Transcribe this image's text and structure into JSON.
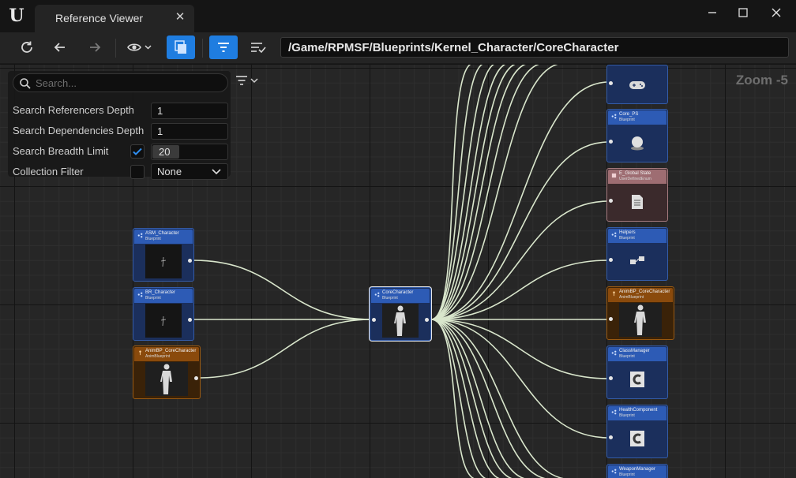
{
  "window": {
    "tab_title": "Reference Viewer",
    "close_glyph": "✕",
    "controls": {
      "minimize": "—",
      "maximize": "☐",
      "close": "✕"
    }
  },
  "toolbar": {
    "buttons": [
      "refresh-icon",
      "back-arrow-icon",
      "forward-arrow-icon",
      "visibility-eye-icon",
      "copy-layers-icon",
      "filter-icon",
      "sort-filter-icon"
    ],
    "path": "/Game/RPMSF/Blueprints/Kernel_Character/CoreCharacter",
    "active_color": "#1f7de0"
  },
  "filters": {
    "search_placeholder": "Search...",
    "referencers_depth_label": "Search Referencers Depth",
    "referencers_depth": "1",
    "dependencies_depth_label": "Search Dependencies Depth",
    "dependencies_depth": "1",
    "breadth_label": "Search Breadth Limit",
    "breadth_enabled": true,
    "breadth_limit": "20",
    "collection_label": "Collection Filter",
    "collection_enabled": false,
    "collection_value": "None"
  },
  "graph": {
    "zoom": "Zoom -5",
    "referencers": [
      {
        "name": "ASM_Character",
        "type": "Blueprint",
        "kind": "bp"
      },
      {
        "name": "BR_Character",
        "type": "Blueprint",
        "kind": "bp"
      },
      {
        "name": "AnimBP_CoreCharacter",
        "type": "AnimBlueprint",
        "kind": "anim"
      }
    ],
    "center": {
      "name": "CoreCharacter",
      "type": "Blueprint",
      "kind": "bp"
    },
    "dependencies": [
      {
        "name": "",
        "type": "",
        "kind": "bp",
        "icon": "gamepad-icon"
      },
      {
        "name": "Core_PS",
        "type": "Blueprint",
        "kind": "bp",
        "icon": "sphere-icon"
      },
      {
        "name": "E_Global State",
        "type": "UserDefinedEnum",
        "kind": "enum",
        "icon": "document-icon"
      },
      {
        "name": "Helpers",
        "type": "Blueprint",
        "kind": "bp",
        "icon": "helpers-icon"
      },
      {
        "name": "AnimBP_CoreCharacter",
        "type": "AnimBlueprint",
        "kind": "anim",
        "icon": "character-icon"
      },
      {
        "name": "ClassManager",
        "type": "Blueprint",
        "kind": "bp",
        "icon": "class-c-icon"
      },
      {
        "name": "HealthComponent",
        "type": "Blueprint",
        "kind": "bp",
        "icon": "class-c-icon"
      },
      {
        "name": "WeaponManager",
        "type": "Blueprint",
        "kind": "bp",
        "icon": "class-c-icon"
      }
    ],
    "wire_color": "#d9e6cc"
  }
}
